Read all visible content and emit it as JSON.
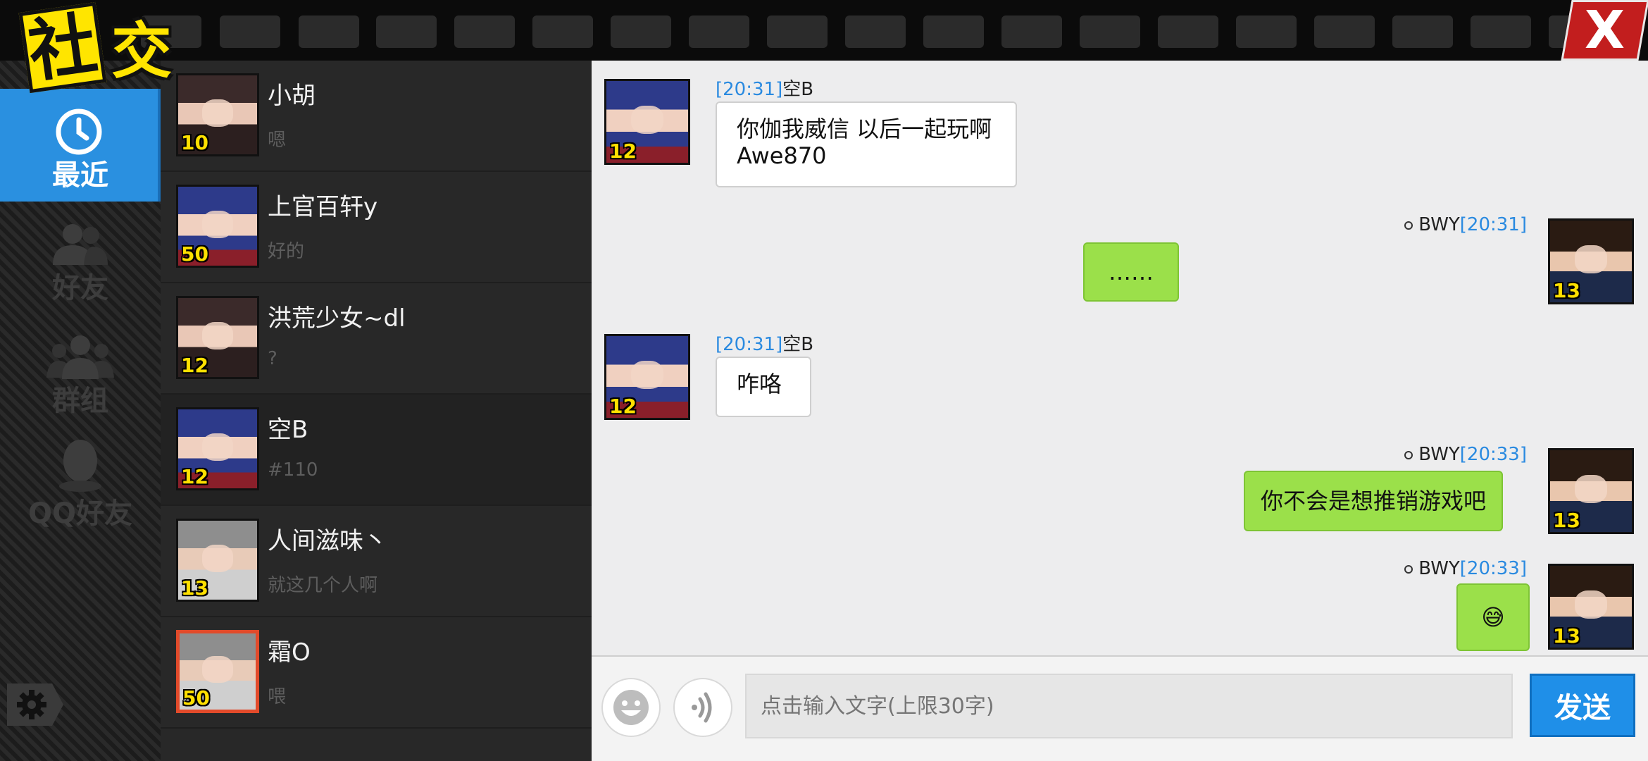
{
  "logo": {
    "char1": "社",
    "char2": "交"
  },
  "close_label": "X",
  "nav": [
    {
      "label": "最近",
      "icon": "clock-icon",
      "active": true
    },
    {
      "label": "好友",
      "icon": "friends-icon",
      "active": false
    },
    {
      "label": "群组",
      "icon": "group-icon",
      "active": false
    },
    {
      "label": "QQ好友",
      "icon": "qq-penguin-icon",
      "active": false
    }
  ],
  "contacts": [
    {
      "name": "小胡",
      "message": "嗯",
      "level": "10"
    },
    {
      "name": "上官百轩y",
      "message": "好的",
      "level": "50"
    },
    {
      "name": "洪荒少女~dl",
      "message": "?",
      "level": "12"
    },
    {
      "name": "空B",
      "message": "#110",
      "level": "12"
    },
    {
      "name": "人间滋味丶",
      "message": "就这几个人啊",
      "level": "13"
    },
    {
      "name": "霜O",
      "message": "喂",
      "level": "50"
    }
  ],
  "chat": {
    "messages": [
      {
        "direction": "in",
        "time": "[20:31]",
        "sender": "空B",
        "text": "你伽我威信 以后一起玩啊 Awe870",
        "level": "12"
      },
      {
        "direction": "out",
        "time": "[20:31]",
        "sender": "BWY",
        "text": "……",
        "level": "13"
      },
      {
        "direction": "in",
        "time": "[20:31]",
        "sender": "空B",
        "text": "咋咯",
        "level": "12"
      },
      {
        "direction": "out",
        "time": "[20:33]",
        "sender": "BWY",
        "text": "你不会是想推销游戏吧",
        "level": "13"
      },
      {
        "direction": "out",
        "time": "[20:33]",
        "sender": "BWY",
        "text": "😅",
        "level": "13"
      }
    ]
  },
  "input": {
    "placeholder": "点击输入文字(上限30字)",
    "send_label": "发送"
  }
}
